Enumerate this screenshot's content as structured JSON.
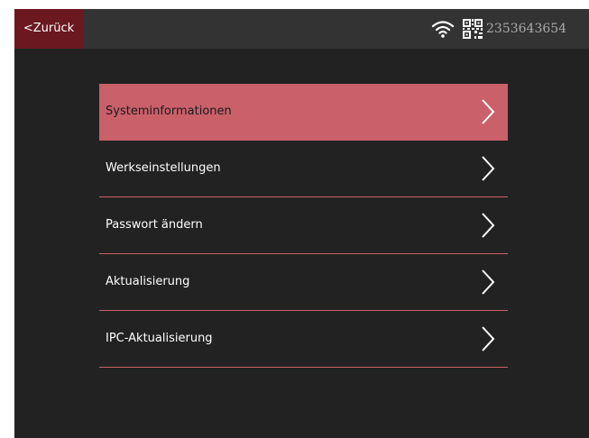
{
  "header": {
    "back_label": "<Zurück",
    "device_id": "2353643654",
    "wifi_icon": "wifi-icon",
    "qr_icon": "qr-code-icon"
  },
  "menu": {
    "items": [
      {
        "label": "Systeminformationen",
        "active": true
      },
      {
        "label": "Werkseinstellungen",
        "active": false
      },
      {
        "label": "Passwort ändern",
        "active": false
      },
      {
        "label": "Aktualisierung",
        "active": false
      },
      {
        "label": "IPC-Aktualisierung",
        "active": false
      }
    ],
    "chevron_icon": "chevron-right-icon"
  },
  "colors": {
    "accent": "#c9606a",
    "back_button": "#6b1820",
    "background": "#222222",
    "topbar": "#333333"
  }
}
